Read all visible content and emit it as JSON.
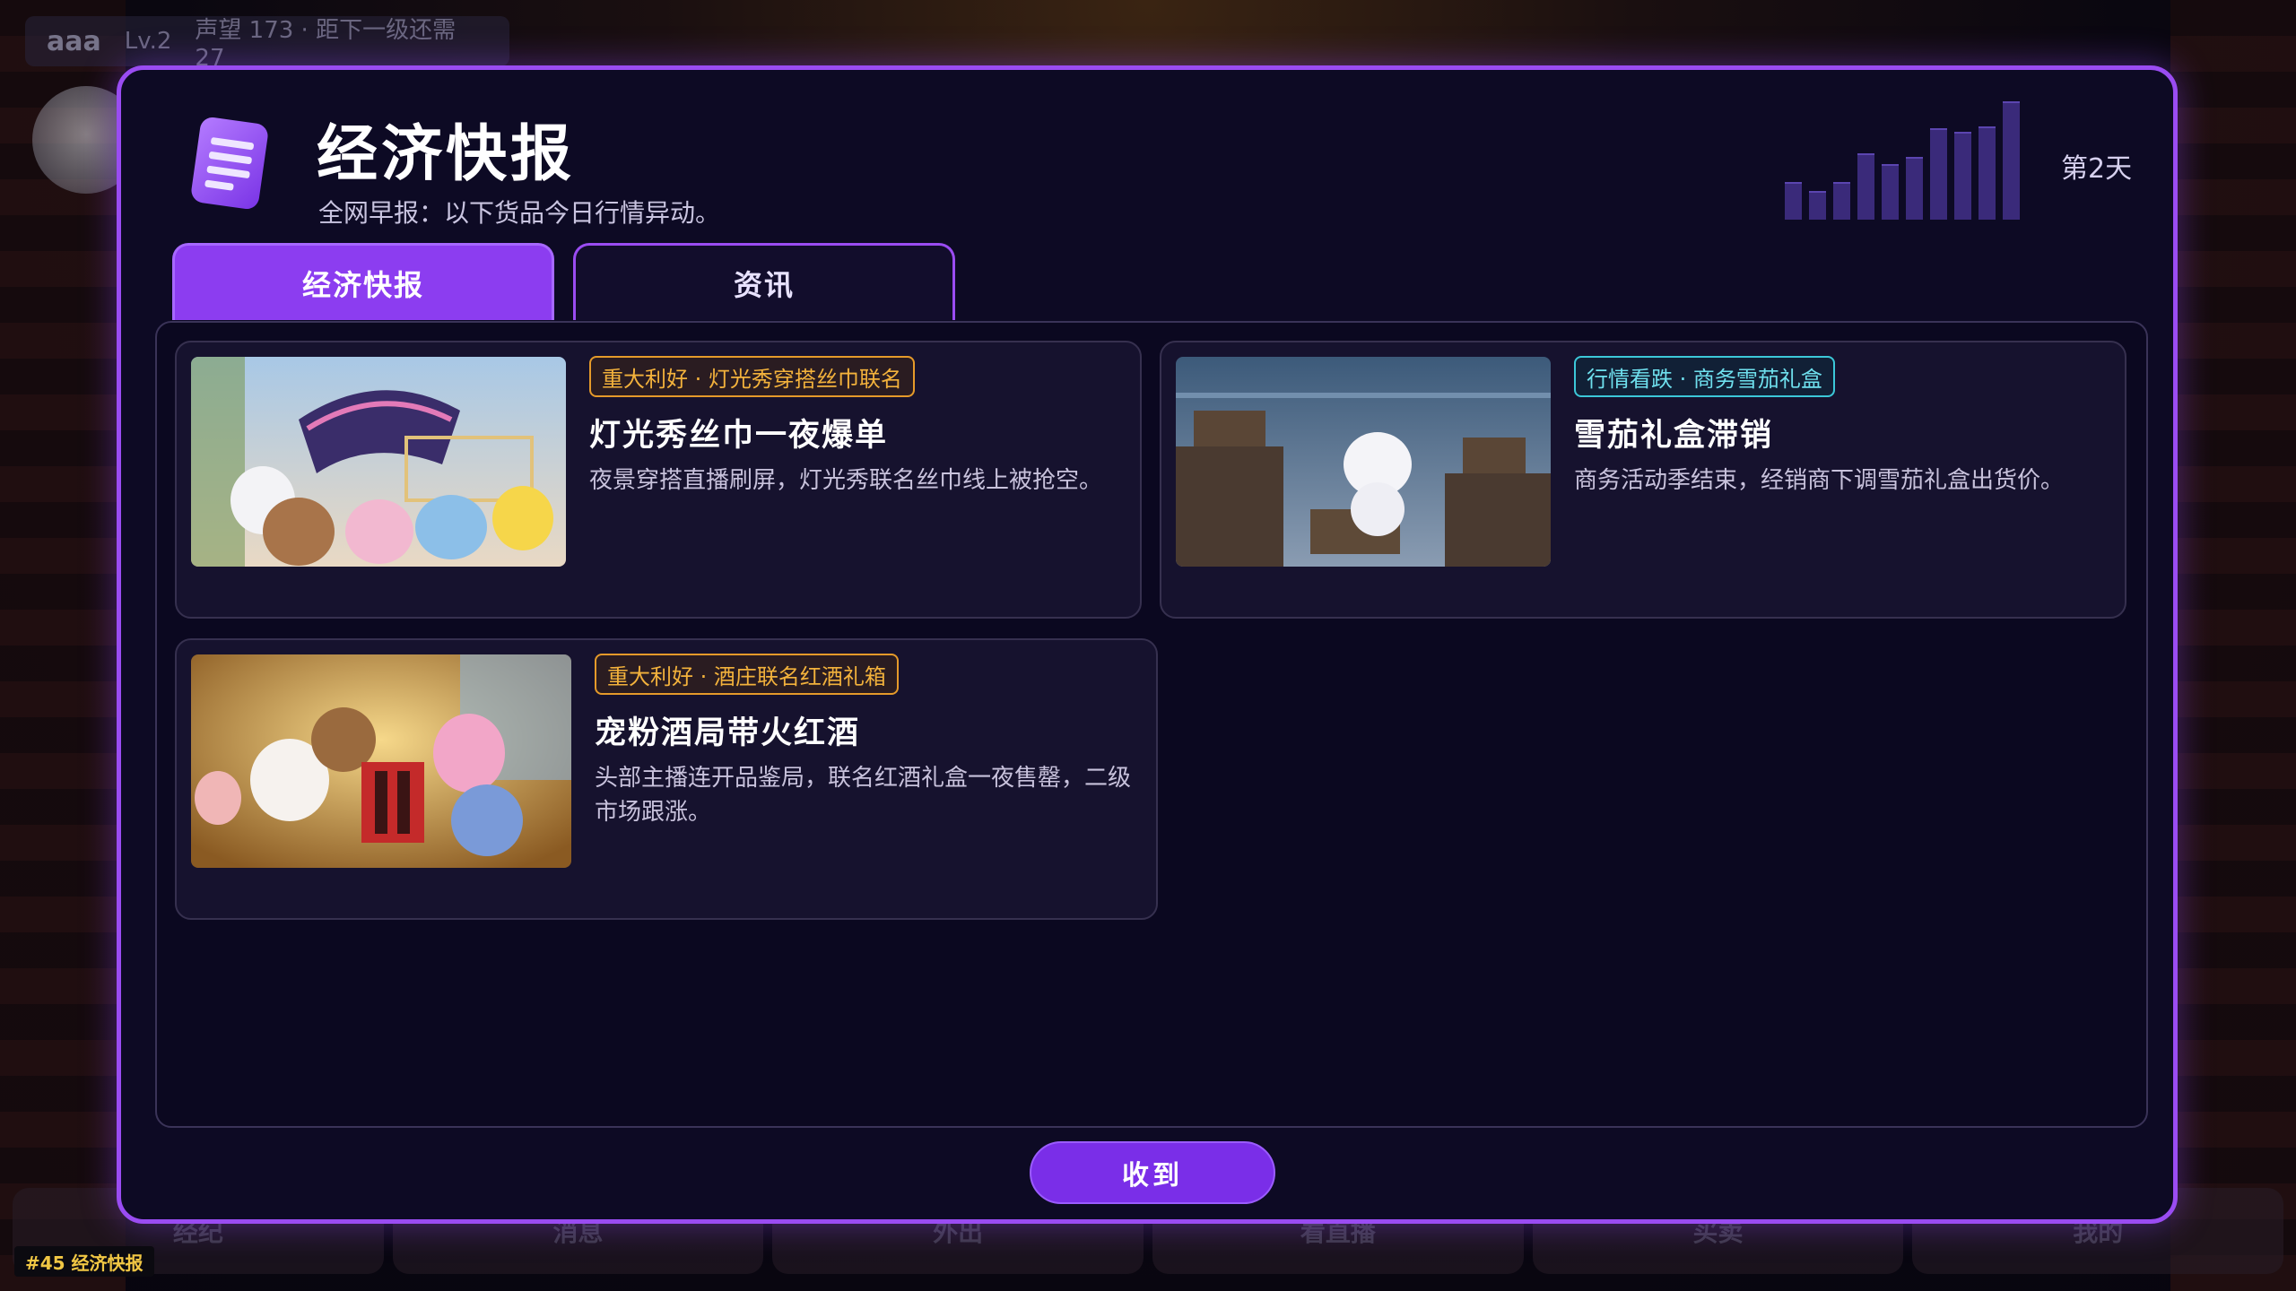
{
  "hud": {
    "player_name": "aaa",
    "level": "Lv.2",
    "reputation": "声望 173 · 距下一级还需 27"
  },
  "bottom_nav": [
    "经纪",
    "消息",
    "外出",
    "看直播",
    "买卖",
    "我的"
  ],
  "debug_tag": "#45 经济快报",
  "modal": {
    "title": "经济快报",
    "subtitle": "全网早报：以下货品今日行情异动。",
    "day": "第2天",
    "tabs": [
      {
        "label": "经济快报",
        "active": true
      },
      {
        "label": "资讯",
        "active": false
      }
    ],
    "cards": [
      {
        "tag": "重大利好 · 灯光秀穿搭丝巾联名",
        "tag_type": "up",
        "title": "灯光秀丝巾一夜爆单",
        "desc": "夜景穿搭直播刷屏，灯光秀联名丝巾线上被抢空。"
      },
      {
        "tag": "行情看跌 · 商务雪茄礼盒",
        "tag_type": "down",
        "title": "雪茄礼盒滞销",
        "desc": "商务活动季结束，经销商下调雪茄礼盒出货价。"
      },
      {
        "tag": "重大利好 · 酒庄联名红酒礼箱",
        "tag_type": "up",
        "title": "宠粉酒局带火红酒",
        "desc": "头部主播连开品鉴局，联名红酒礼盒一夜售罄，二级市场跟涨。"
      }
    ],
    "receive_label": "收到"
  },
  "colors": {
    "accent": "#8c3df0",
    "modal_border": "#9a4cf2",
    "tag_up": "#f3b23c",
    "tag_down": "#6fe0ee"
  }
}
